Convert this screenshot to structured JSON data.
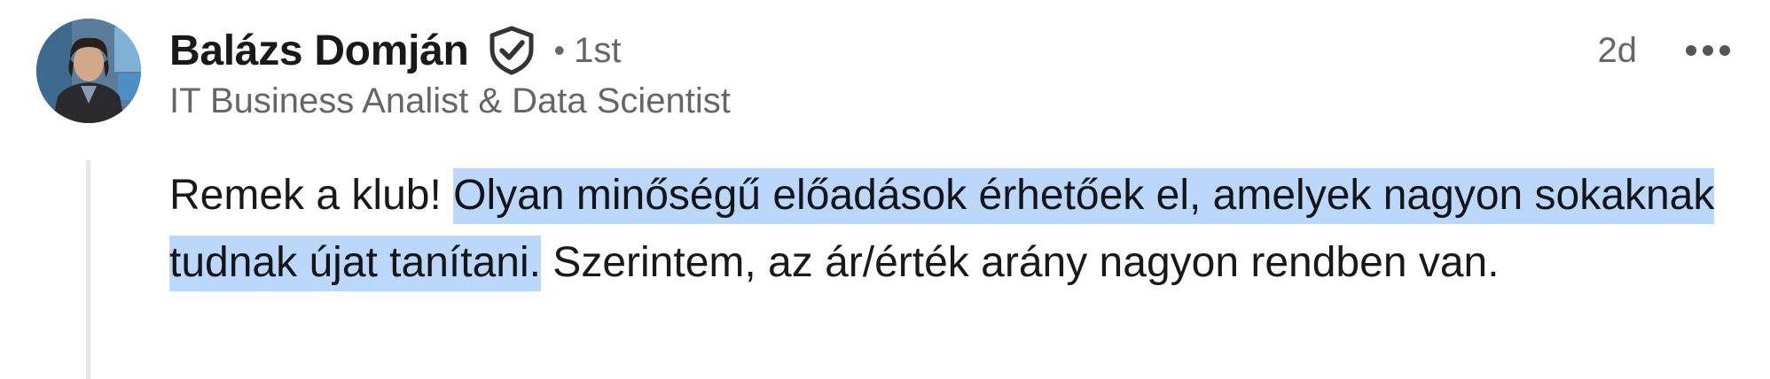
{
  "comment": {
    "author": {
      "name": "Balázs Domján",
      "verified_icon": "verified-shield-icon",
      "degree_separator": "•",
      "degree": "1st",
      "headline": "IT Business Analist & Data Scientist",
      "avatar_icon": "avatar-photo"
    },
    "time": "2d",
    "more_icon": "ellipsis-icon",
    "text": {
      "before_highlight": "Remek a klub! ",
      "highlighted": "Olyan minőségű előadások érhetőek el, amelyek nagyon sokaknak tudnak újat tanítani.",
      "after_highlight": " Szerintem, az ár/érték arány nagyon rendben van."
    },
    "colors": {
      "highlight": "#bcd7fc",
      "secondary_text": "#666666",
      "thread_line": "#e8e5e2"
    }
  }
}
